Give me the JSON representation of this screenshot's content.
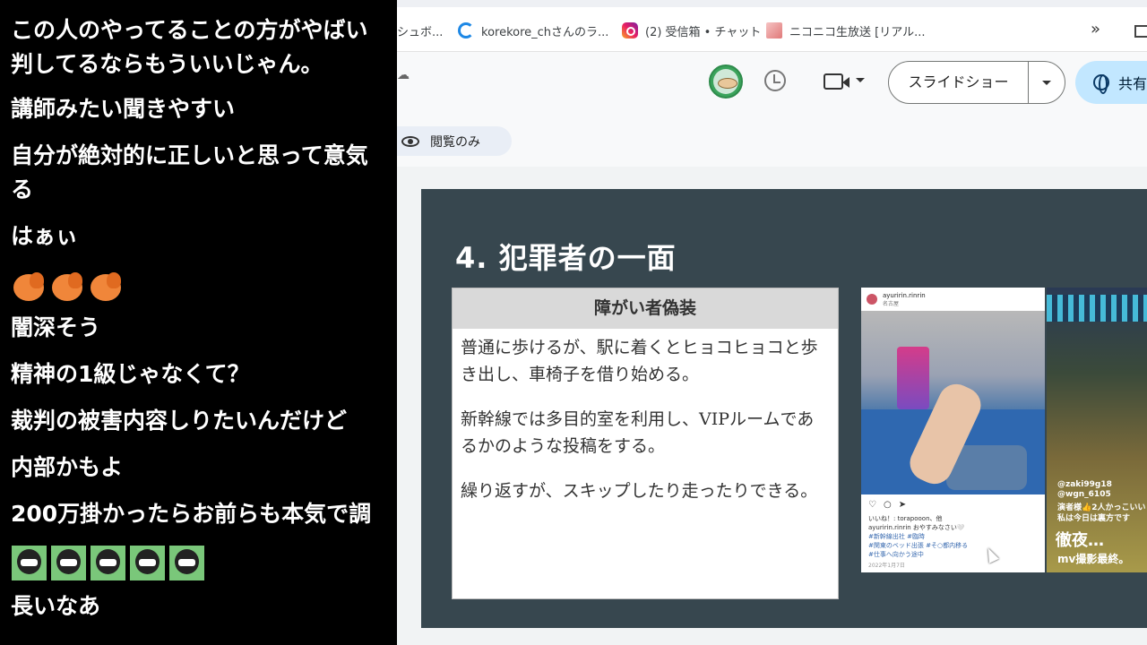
{
  "comments": [
    "この人のやってることの方がやばい",
    "判してるならもういいじゃん。",
    "講師みたい聞きやすい",
    "自分が絶対的に正しいと思って意気",
    "る",
    "はぁぃ",
    "闇深そう",
    "精神の1級じゃなくて？",
    "裁判の被害内容しりたいんだけど",
    "内部かもよ",
    "200万掛かったらお前らも本気で調",
    "長いなあ"
  ],
  "emoji": {
    "bird_icon": "bird-emoji-icon",
    "ninja_icon": "ninja-emoji-icon"
  },
  "bookmarks": [
    {
      "label": "シュボ...",
      "icon": "none"
    },
    {
      "label": "korekore_chさんのラ...",
      "icon": "edge-icon"
    },
    {
      "label": "(2) 受信箱 • チャット",
      "icon": "instagram-icon"
    },
    {
      "label": "ニコニコ生放送 [リアル...",
      "icon": "nicovideo-icon"
    }
  ],
  "bookmarks_more": "»",
  "toolbar": {
    "slideshow_label": "スライドショー",
    "share_label": "共有"
  },
  "viewonly_label": "閲覧のみ",
  "slide": {
    "title": "4. 犯罪者の一面",
    "box_header": "障がい者偽装",
    "paragraphs": [
      "普通に歩けるが、駅に着くとヒョコヒョコと歩き出し、車椅子を借り始める。",
      "新幹線では多目的室を利用し、VIPルームであるかのような投稿をする。",
      "繰り返すが、スキップしたり走ったりできる。"
    ],
    "post1": {
      "username": "ayuririn.rinrin",
      "sub": "名古屋",
      "likes": "いいね！: torapooon、他",
      "caption": "ayuririn.rinrin おやすみなさい🤍",
      "tags": [
        "#新幹線出社 #臨時",
        "#関東のベッド出張 #そ○都内移る",
        "#仕事へ向かう途中"
      ],
      "date": "2022年1月7日"
    },
    "post2": {
      "tag1": "@zaki99g18",
      "tag2": "@wgn_6105",
      "line": "演者様👍2人かっこいい",
      "line2": "私は今日は裏方です",
      "big": "徹夜…",
      "small": "mv撮影最終。"
    }
  }
}
